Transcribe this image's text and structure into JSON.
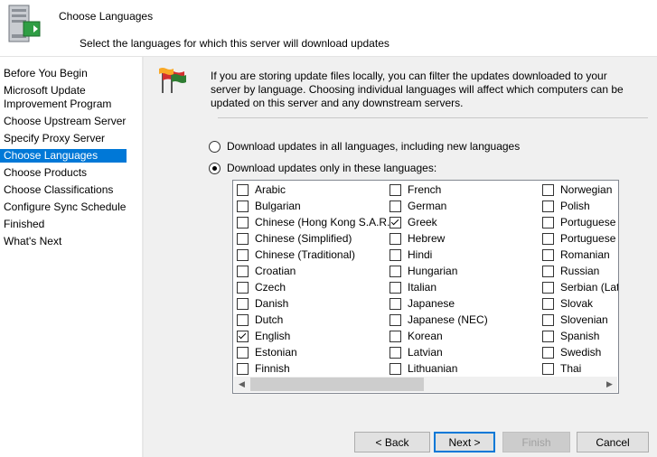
{
  "header": {
    "title": "Choose Languages",
    "subtitle": "Select the languages for which this server will download updates"
  },
  "nav": {
    "items": [
      {
        "label": "Before You Begin"
      },
      {
        "label": "Microsoft Update"
      },
      {
        "label": "Improvement Program"
      },
      {
        "label": "Choose Upstream Server"
      },
      {
        "label": "Specify Proxy Server"
      },
      {
        "label": "Choose Languages",
        "selected": true
      },
      {
        "label": "Choose Products"
      },
      {
        "label": "Choose Classifications"
      },
      {
        "label": "Configure Sync Schedule"
      },
      {
        "label": "Finished"
      },
      {
        "label": "What's Next"
      }
    ]
  },
  "intro": {
    "line1": "If you are storing update files locally, you can filter the updates downloaded to your",
    "line2": "server by language. Choosing individual languages will affect which computers can be",
    "line3": "updated on this server and any downstream servers."
  },
  "options": {
    "all": {
      "label": "Download updates in all languages, including new languages",
      "checked": false
    },
    "only": {
      "label": "Download updates only in these languages:",
      "checked": true
    }
  },
  "languages": {
    "col1": [
      {
        "label": "Arabic",
        "checked": false
      },
      {
        "label": "Bulgarian",
        "checked": false
      },
      {
        "label": "Chinese (Hong Kong S.A.R.)",
        "checked": false
      },
      {
        "label": "Chinese (Simplified)",
        "checked": false
      },
      {
        "label": "Chinese (Traditional)",
        "checked": false
      },
      {
        "label": "Croatian",
        "checked": false
      },
      {
        "label": "Czech",
        "checked": false
      },
      {
        "label": "Danish",
        "checked": false
      },
      {
        "label": "Dutch",
        "checked": false
      },
      {
        "label": "English",
        "checked": true
      },
      {
        "label": "Estonian",
        "checked": false
      },
      {
        "label": "Finnish",
        "checked": false
      }
    ],
    "col2": [
      {
        "label": "French",
        "checked": false
      },
      {
        "label": "German",
        "checked": false
      },
      {
        "label": "Greek",
        "checked": true
      },
      {
        "label": "Hebrew",
        "checked": false
      },
      {
        "label": "Hindi",
        "checked": false
      },
      {
        "label": "Hungarian",
        "checked": false
      },
      {
        "label": "Italian",
        "checked": false
      },
      {
        "label": "Japanese",
        "checked": false
      },
      {
        "label": "Japanese (NEC)",
        "checked": false
      },
      {
        "label": "Korean",
        "checked": false
      },
      {
        "label": "Latvian",
        "checked": false
      },
      {
        "label": "Lithuanian",
        "checked": false
      }
    ],
    "col3": [
      {
        "label": "Norwegian",
        "checked": false
      },
      {
        "label": "Polish",
        "checked": false
      },
      {
        "label": "Portuguese",
        "checked": false
      },
      {
        "label": "Portuguese",
        "checked": false
      },
      {
        "label": "Romanian",
        "checked": false
      },
      {
        "label": "Russian",
        "checked": false
      },
      {
        "label": "Serbian (Lati",
        "checked": false
      },
      {
        "label": "Slovak",
        "checked": false
      },
      {
        "label": "Slovenian",
        "checked": false
      },
      {
        "label": "Spanish",
        "checked": false
      },
      {
        "label": "Swedish",
        "checked": false
      },
      {
        "label": "Thai",
        "checked": false
      }
    ]
  },
  "buttons": {
    "back": "< Back",
    "next": "Next >",
    "finish": "Finish",
    "cancel": "Cancel"
  },
  "colors": {
    "selection": "#0078d7",
    "panel_bg": "#f0f0f0"
  }
}
